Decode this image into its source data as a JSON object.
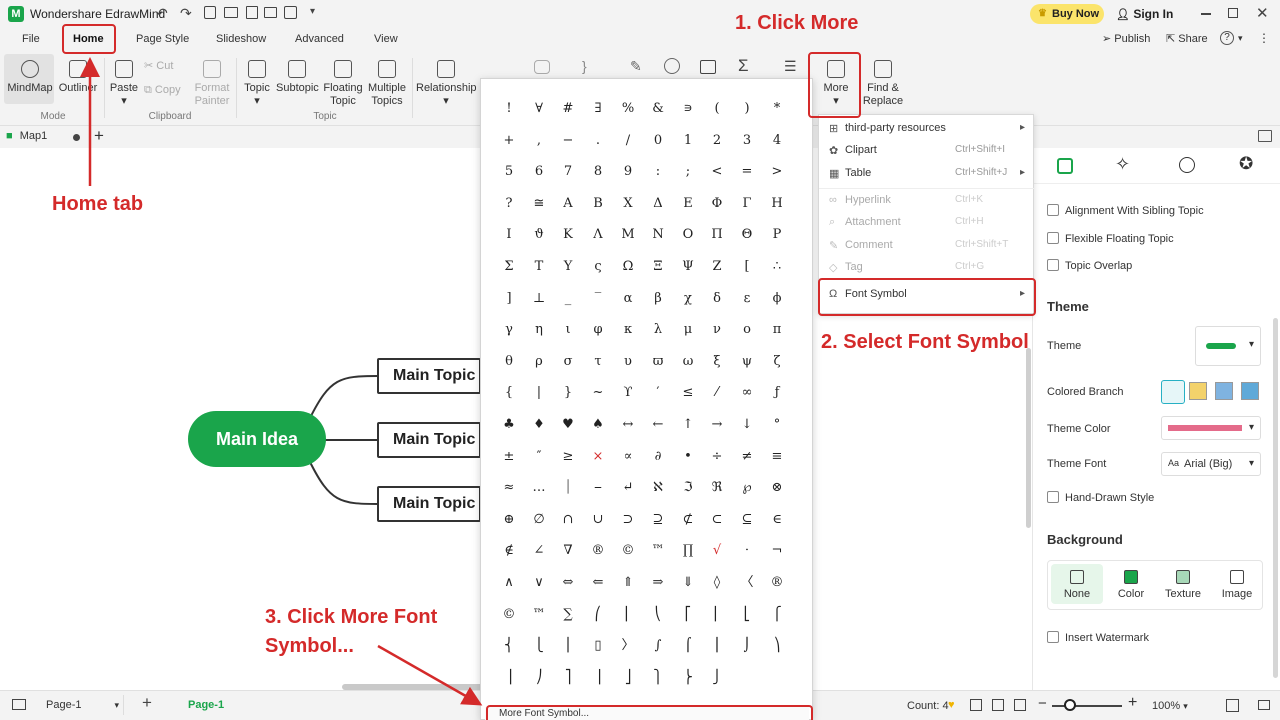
{
  "app": {
    "title": "Wondershare EdrawMind",
    "buy_now": "Buy Now",
    "sign_in": "Sign In",
    "publish": "Publish",
    "share": "Share",
    "help": "?"
  },
  "menu_tabs": [
    "File",
    "Home",
    "Page Style",
    "Slideshow",
    "Advanced",
    "View"
  ],
  "ribbon": {
    "mode": {
      "mindmap": "MindMap",
      "outliner": "Outliner",
      "label": "Mode"
    },
    "clipboard": {
      "paste": "Paste",
      "cut": "Cut",
      "copy": "Copy",
      "format_painter_1": "Format",
      "format_painter_2": "Painter",
      "label": "Clipboard"
    },
    "topic": {
      "topic": "Topic",
      "subtopic": "Subtopic",
      "floating_1": "Floating",
      "floating_2": "Topic",
      "multiple_1": "Multiple",
      "multiple_2": "Topics",
      "label": "Topic"
    },
    "relationship": "Relationship",
    "more": "More",
    "find_1": "Find &",
    "find_2": "Replace"
  },
  "doc_tab": "Map1",
  "mindmap": {
    "main_idea": "Main Idea",
    "topics": [
      "Main Topic",
      "Main Topic",
      "Main Topic"
    ]
  },
  "symbols": [
    [
      "!",
      "∀",
      "#",
      "∃",
      "%",
      "&",
      "∍",
      "(",
      ")",
      "*"
    ],
    [
      "+",
      ",",
      "−",
      ".",
      "/",
      "0",
      "1",
      "2",
      "3",
      "4"
    ],
    [
      "5",
      "6",
      "7",
      "8",
      "9",
      ":",
      ";",
      "<",
      "=",
      ">"
    ],
    [
      "?",
      "≅",
      "Α",
      "Β",
      "Χ",
      "Δ",
      "Ε",
      "Φ",
      "Γ",
      "Η"
    ],
    [
      "Ι",
      "ϑ",
      "Κ",
      "Λ",
      "Μ",
      "Ν",
      "Ο",
      "Π",
      "Θ",
      "Ρ"
    ],
    [
      "Σ",
      "Τ",
      "Υ",
      "ς",
      "Ω",
      "Ξ",
      "Ψ",
      "Ζ",
      "[",
      "∴"
    ],
    [
      "]",
      "⊥",
      "_",
      "‾",
      "α",
      "β",
      "χ",
      "δ",
      "ε",
      "ϕ"
    ],
    [
      "γ",
      "η",
      "ι",
      "φ",
      "κ",
      "λ",
      "μ",
      "ν",
      "ο",
      "π"
    ],
    [
      "θ",
      "ρ",
      "σ",
      "τ",
      "υ",
      "ϖ",
      "ω",
      "ξ",
      "ψ",
      "ζ"
    ],
    [
      "{",
      "|",
      "}",
      "~",
      "ϒ",
      "′",
      "≤",
      "⁄",
      "∞",
      "ƒ"
    ],
    [
      "♣",
      "♦",
      "♥",
      "♠",
      "↔",
      "←",
      "↑",
      "→",
      "↓",
      "°"
    ],
    [
      "±",
      "″",
      "≥",
      "×",
      "∝",
      "∂",
      "•",
      "÷",
      "≠",
      "≡"
    ],
    [
      "≈",
      "…",
      "⏐",
      "⎯",
      "↵",
      "ℵ",
      "ℑ",
      "ℜ",
      "℘",
      "⊗"
    ],
    [
      "⊕",
      "∅",
      "∩",
      "∪",
      "⊃",
      "⊇",
      "⊄",
      "⊂",
      "⊆",
      "∈"
    ],
    [
      "∉",
      "∠",
      "∇",
      "®",
      "©",
      "™",
      "∏",
      "√",
      "⋅",
      "¬"
    ],
    [
      "∧",
      "∨",
      "⇔",
      "⇐",
      "⇑",
      "⇒",
      "⇓",
      "◊",
      "〈",
      "®"
    ],
    [
      "©",
      "™",
      "∑",
      "⎛",
      "⎜",
      "⎝",
      "⎡",
      "⎢",
      "⎣",
      "⎧"
    ],
    [
      "⎨",
      "⎩",
      "⎪",
      "▯",
      "〉",
      "∫",
      "⌠",
      "⎮",
      "⌡",
      "⎞"
    ],
    [
      "⎟",
      "⎠",
      "⎤",
      "⎥",
      "⎦",
      "⎫",
      "⎬",
      "⎭",
      "",
      ""
    ]
  ],
  "more_font_symbol": "More Font Symbol...",
  "more_menu": [
    {
      "label": "third-party resources",
      "shortcut": "",
      "arrow": true,
      "disabled": false,
      "icon": "⊞"
    },
    {
      "label": "Clipart",
      "shortcut": "Ctrl+Shift+I",
      "arrow": false,
      "disabled": false,
      "icon": "✿"
    },
    {
      "label": "Table",
      "shortcut": "Ctrl+Shift+J",
      "arrow": true,
      "disabled": false,
      "icon": "▦"
    },
    {
      "label": "Hyperlink",
      "shortcut": "Ctrl+K",
      "arrow": false,
      "disabled": true,
      "icon": "∞"
    },
    {
      "label": "Attachment",
      "shortcut": "Ctrl+H",
      "arrow": false,
      "disabled": true,
      "icon": "⌕"
    },
    {
      "label": "Comment",
      "shortcut": "Ctrl+Shift+T",
      "arrow": false,
      "disabled": true,
      "icon": "✎"
    },
    {
      "label": "Tag",
      "shortcut": "Ctrl+G",
      "arrow": false,
      "disabled": true,
      "icon": "◇"
    },
    {
      "label": "Font Symbol",
      "shortcut": "",
      "arrow": true,
      "disabled": false,
      "icon": "Ω"
    }
  ],
  "right_panel": {
    "checks": [
      "Alignment With Sibling Topic",
      "Flexible Floating Topic",
      "Topic Overlap"
    ],
    "theme_heading": "Theme",
    "theme_label": "Theme",
    "colored_branch": "Colored Branch",
    "theme_color": "Theme Color",
    "theme_font": "Theme Font",
    "font_value": "Arial (Big)",
    "hand_drawn": "Hand-Drawn Style",
    "background_heading": "Background",
    "bg_options": [
      "None",
      "Color",
      "Texture",
      "Image"
    ],
    "insert_watermark": "Insert Watermark"
  },
  "status": {
    "page_select": "Page-1",
    "page_tab": "Page-1",
    "count": "Count: 4",
    "zoom": "100%"
  },
  "annotations": {
    "click_more": "1. Click More",
    "home_tab": "Home tab",
    "select_font_symbol": "2. Select Font Symbol",
    "click_more_font_1": "3. Click More Font",
    "click_more_font_2": "Symbol..."
  },
  "colors": {
    "accent_green": "#1aa54b",
    "annotation_red": "#d42a2a",
    "buy_now_bg": "#fbe46b"
  }
}
